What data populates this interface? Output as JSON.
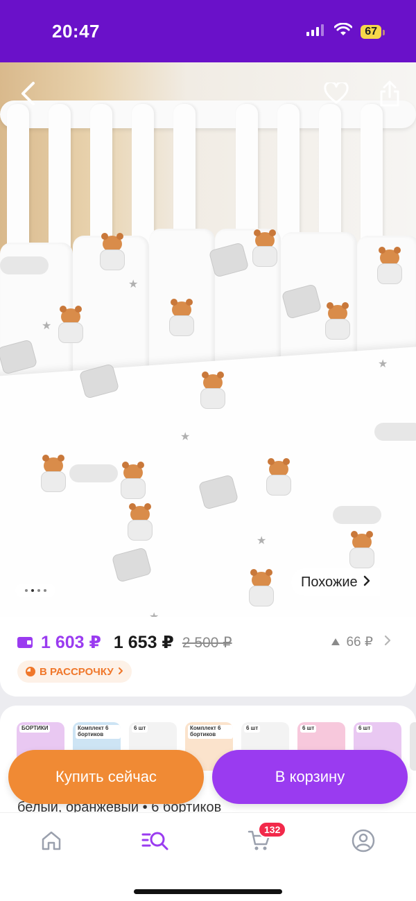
{
  "status_bar": {
    "time": "20:47",
    "battery": "67",
    "icons": [
      "signal-icon",
      "wifi-icon",
      "battery-icon"
    ]
  },
  "product_photo": {
    "similar_label": "Похожие",
    "gallery_dots": 4,
    "active_dot": 2
  },
  "price": {
    "wallet_price": "1 603 ₽",
    "regular_price": "1 653 ₽",
    "old_price": "2 500 ₽",
    "price_drop": "66 ₽",
    "installment_label": "В РАССРОЧКУ"
  },
  "variants": [
    {
      "tag": "БОРТИКИ",
      "style": "lilac"
    },
    {
      "tag": "Комплект 6 бортиков",
      "style": "blue"
    },
    {
      "tag": "6 шт",
      "style": "plain"
    },
    {
      "tag": "Комплект 6 бортиков",
      "style": "peach"
    },
    {
      "tag": "6 шт",
      "style": "plain"
    },
    {
      "tag": "6 шт",
      "style": "pink"
    },
    {
      "tag": "6 шт",
      "style": "lilac"
    }
  ],
  "description_snippet": "белый, оранжевый • 6 бортиков",
  "actions": {
    "buy_now": "Купить сейчас",
    "add_to_cart": "В корзину"
  },
  "tabbar": {
    "cart_count": "132"
  },
  "colors": {
    "brand_purple": "#6a11c9",
    "accent_purple": "#9a3bf0",
    "accent_orange": "#f08a34",
    "badge_red": "#f2294a"
  }
}
